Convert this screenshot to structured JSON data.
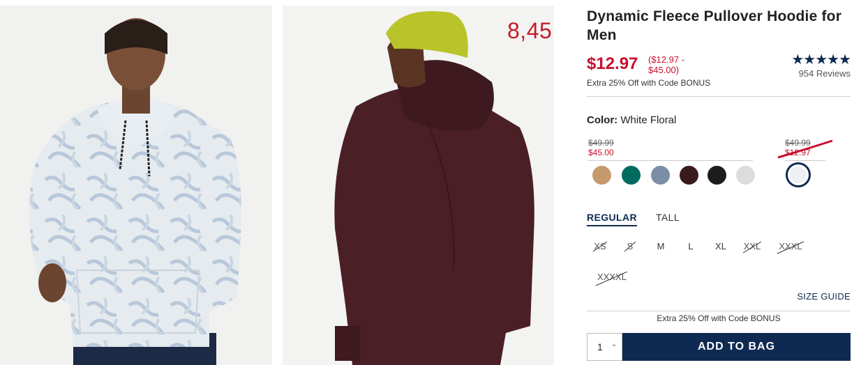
{
  "overlay_price": "8,45",
  "product": {
    "title": "Dynamic Fleece Pullover Hoodie for Men",
    "price": "$12.97",
    "price_range": "($12.97 - $45.00)",
    "promo": "Extra 25% Off with Code BONUS",
    "rating": {
      "stars": "★★★★★",
      "value": 5,
      "reviews": "954 Reviews"
    }
  },
  "color": {
    "label": "Color:",
    "value": "White Floral"
  },
  "price_groups": [
    {
      "old": "$49.99",
      "sale": "$45.00"
    },
    {
      "old": "$49.99",
      "sale": "$12.97"
    }
  ],
  "swatches": [
    {
      "name": "tan",
      "color": "#c79a6e"
    },
    {
      "name": "teal",
      "color": "#006b5e"
    },
    {
      "name": "slate blue",
      "color": "#7c8ea6"
    },
    {
      "name": "burgundy",
      "color": "#3b1a1f"
    },
    {
      "name": "black",
      "color": "#1c1c1c"
    },
    {
      "name": "light gray",
      "color": "#dcdcdc"
    },
    {
      "name": "white floral",
      "color": "#eef0f3",
      "selected": true
    }
  ],
  "fit_tabs": [
    {
      "label": "REGULAR",
      "active": true
    },
    {
      "label": "TALL",
      "active": false
    }
  ],
  "sizes": [
    {
      "label": "XS",
      "available": false
    },
    {
      "label": "S",
      "available": false
    },
    {
      "label": "M",
      "available": true
    },
    {
      "label": "L",
      "available": true
    },
    {
      "label": "XL",
      "available": true
    },
    {
      "label": "XXL",
      "available": false
    },
    {
      "label": "XXXL",
      "available": false
    },
    {
      "label": "XXXXL",
      "available": false
    }
  ],
  "size_guide": "SIZE GUIDE",
  "promo_bottom": "Extra 25% Off with Code BONUS",
  "quantity": "1",
  "add_to_bag": "ADD TO BAG",
  "colors": {
    "accent_red": "#c8102e",
    "navy": "#0f2a52"
  }
}
